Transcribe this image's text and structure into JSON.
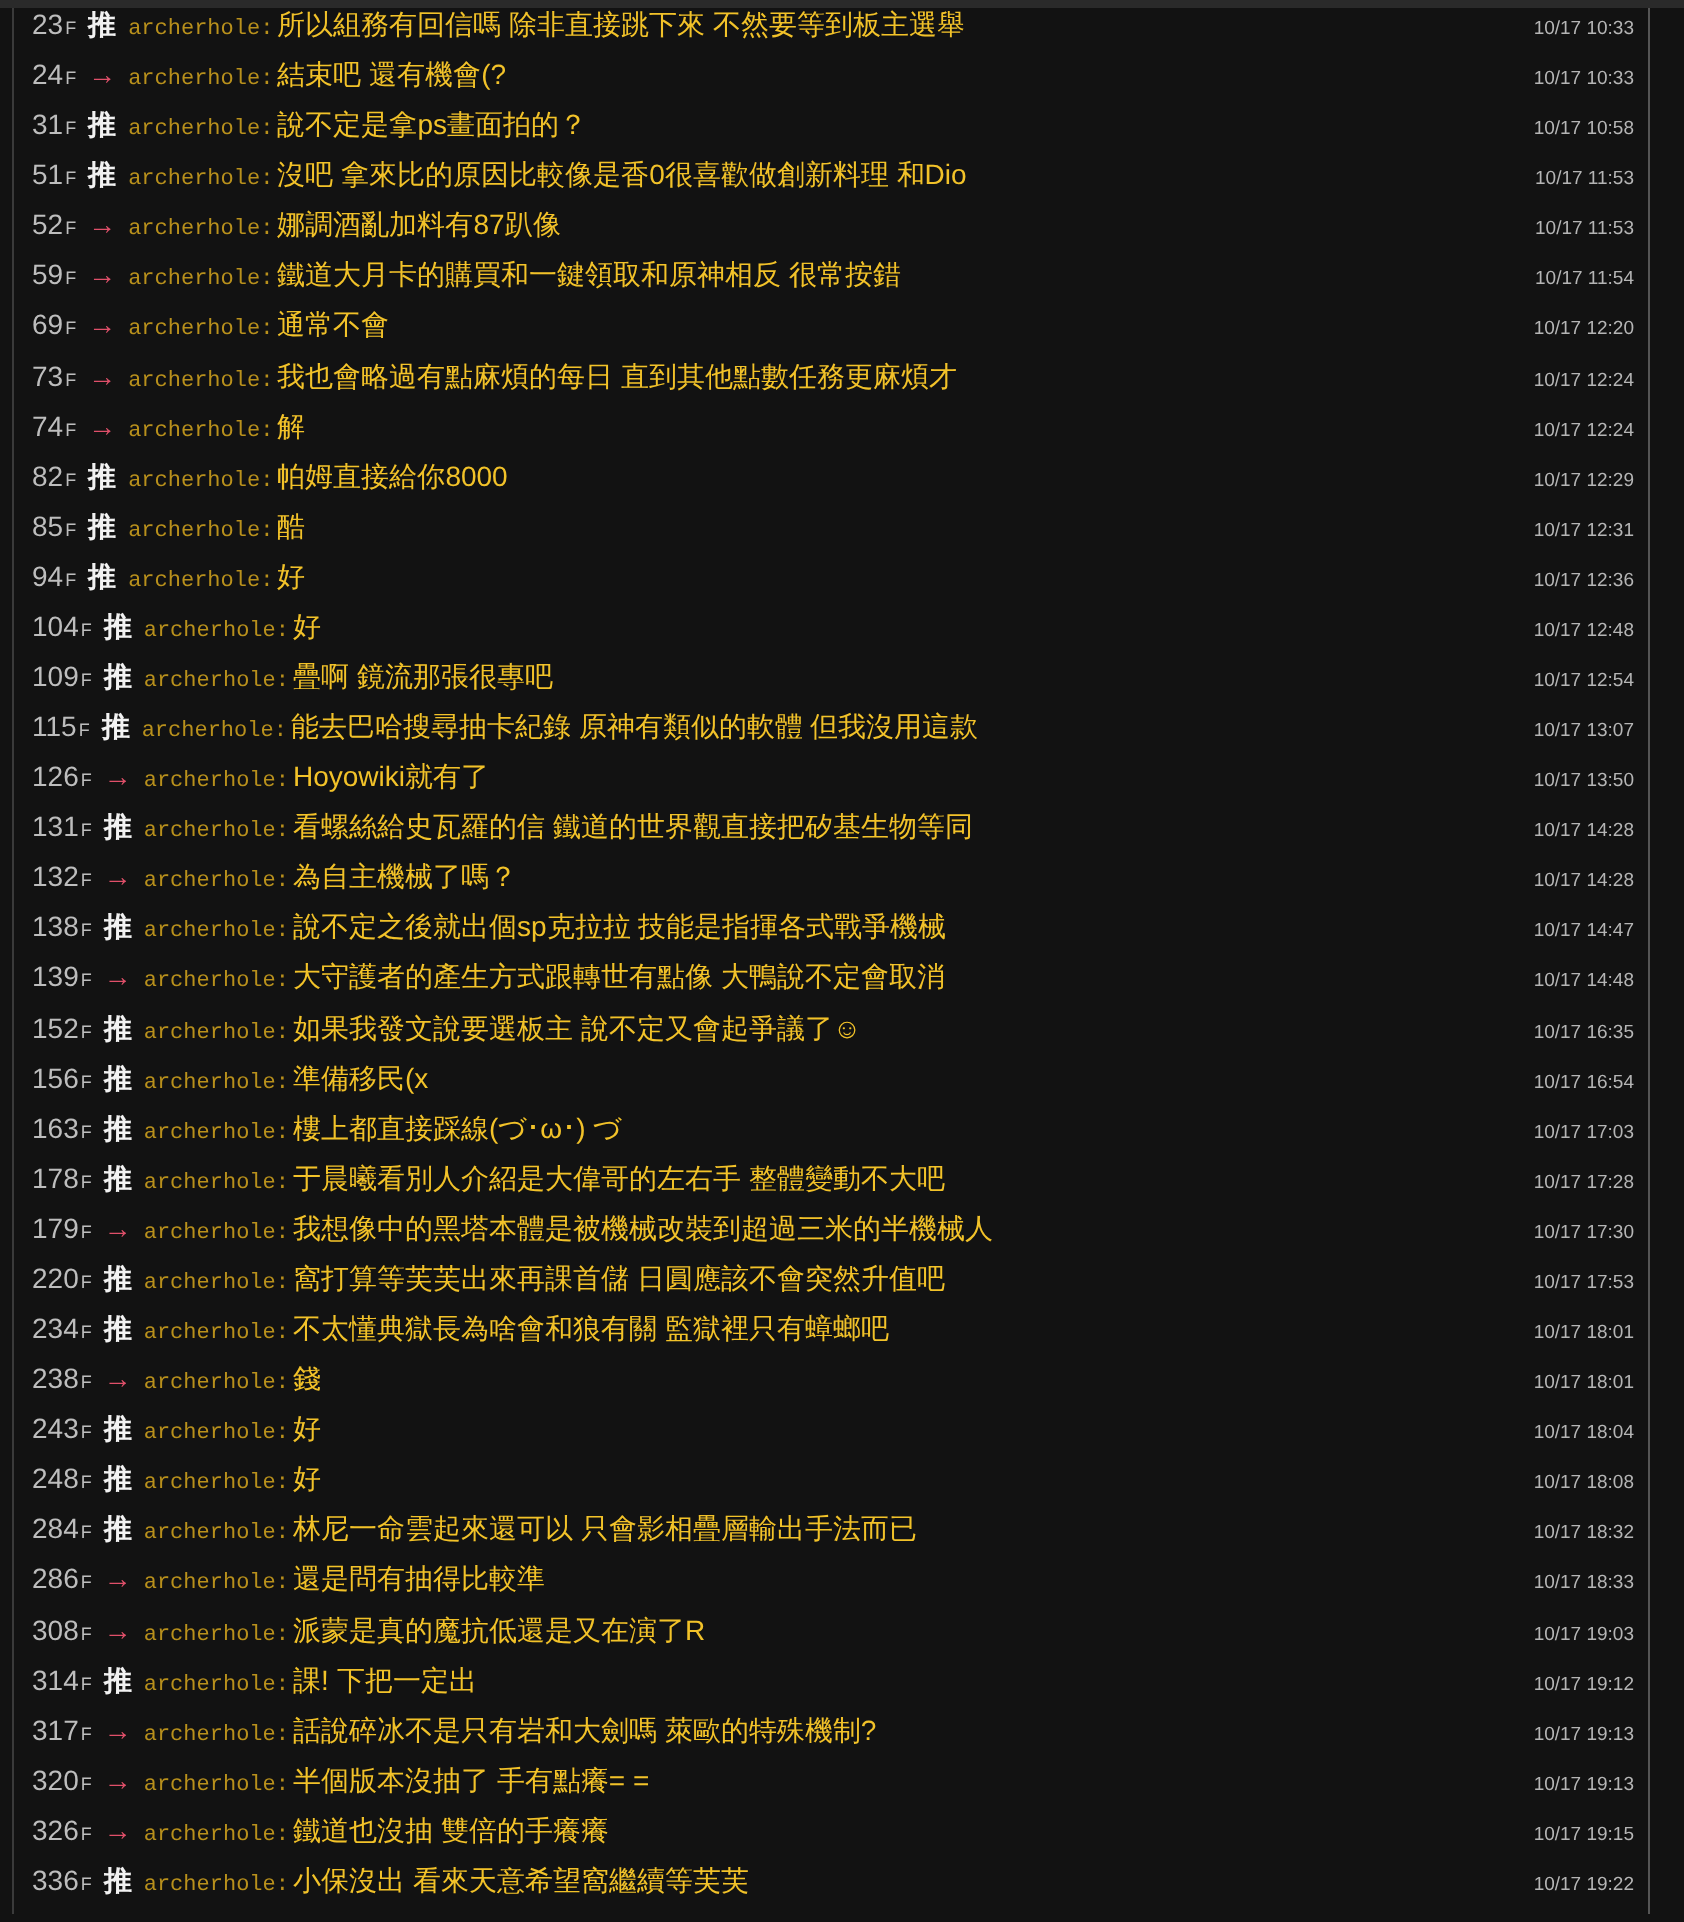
{
  "comments": [
    {
      "floor": "23",
      "floor_mark": "F",
      "kind": "push",
      "tag": "推",
      "user": "archerhole:",
      "content": "所以組務有回信嗎 除非直接跳下來 不然要等到板主選舉",
      "time": "10/17 10:33"
    },
    {
      "floor": "24",
      "floor_mark": "F",
      "kind": "arrow",
      "tag": "→",
      "user": "archerhole:",
      "content": "結束吧 還有機會(?",
      "time": "10/17 10:33"
    },
    {
      "floor": "31",
      "floor_mark": "F",
      "kind": "push",
      "tag": "推",
      "user": "archerhole:",
      "content": "說不定是拿ps畫面拍的？",
      "time": "10/17 10:58"
    },
    {
      "floor": "51",
      "floor_mark": "F",
      "kind": "push",
      "tag": "推",
      "user": "archerhole:",
      "content": "沒吧 拿來比的原因比較像是香0很喜歡做創新料理 和Dio",
      "time": "10/17 11:53"
    },
    {
      "floor": "52",
      "floor_mark": "F",
      "kind": "arrow",
      "tag": "→",
      "user": "archerhole:",
      "content": "娜調酒亂加料有87趴像",
      "time": "10/17 11:53"
    },
    {
      "floor": "59",
      "floor_mark": "F",
      "kind": "arrow",
      "tag": "→",
      "user": "archerhole:",
      "content": "鐵道大月卡的購買和一鍵領取和原神相反 很常按錯",
      "time": "10/17 11:54"
    },
    {
      "floor": "69",
      "floor_mark": "F",
      "kind": "arrow",
      "tag": "→",
      "user": "archerhole:",
      "content": "通常不會",
      "time": "10/17 12:20"
    },
    {
      "floor": "73",
      "floor_mark": "F",
      "kind": "arrow",
      "tag": "→",
      "user": "archerhole:",
      "content": "我也會略過有點麻煩的每日 直到其他點數任務更麻煩才",
      "time": "10/17 12:24"
    },
    {
      "floor": "74",
      "floor_mark": "F",
      "kind": "arrow",
      "tag": "→",
      "user": "archerhole:",
      "content": "解",
      "time": "10/17 12:24"
    },
    {
      "floor": "82",
      "floor_mark": "F",
      "kind": "push",
      "tag": "推",
      "user": "archerhole:",
      "content": "帕姆直接給你8000",
      "time": "10/17 12:29"
    },
    {
      "floor": "85",
      "floor_mark": "F",
      "kind": "push",
      "tag": "推",
      "user": "archerhole:",
      "content": "酷",
      "time": "10/17 12:31"
    },
    {
      "floor": "94",
      "floor_mark": "F",
      "kind": "push",
      "tag": "推",
      "user": "archerhole:",
      "content": "好",
      "time": "10/17 12:36"
    },
    {
      "floor": "104",
      "floor_mark": "F",
      "kind": "push",
      "tag": "推",
      "user": "archerhole:",
      "content": "好",
      "time": "10/17 12:48"
    },
    {
      "floor": "109",
      "floor_mark": "F",
      "kind": "push",
      "tag": "推",
      "user": "archerhole:",
      "content": "疊啊 鏡流那張很專吧",
      "time": "10/17 12:54"
    },
    {
      "floor": "115",
      "floor_mark": "F",
      "kind": "push",
      "tag": "推",
      "user": "archerhole:",
      "content": "能去巴哈搜尋抽卡紀錄 原神有類似的軟體 但我沒用這款",
      "time": "10/17 13:07"
    },
    {
      "floor": "126",
      "floor_mark": "F",
      "kind": "arrow",
      "tag": "→",
      "user": "archerhole:",
      "content": "Hoyowiki就有了",
      "time": "10/17 13:50"
    },
    {
      "floor": "131",
      "floor_mark": "F",
      "kind": "push",
      "tag": "推",
      "user": "archerhole:",
      "content": "看螺絲給史瓦羅的信 鐵道的世界觀直接把矽基生物等同",
      "time": "10/17 14:28"
    },
    {
      "floor": "132",
      "floor_mark": "F",
      "kind": "arrow",
      "tag": "→",
      "user": "archerhole:",
      "content": "為自主機械了嗎？",
      "time": "10/17 14:28"
    },
    {
      "floor": "138",
      "floor_mark": "F",
      "kind": "push",
      "tag": "推",
      "user": "archerhole:",
      "content": "說不定之後就出個sp克拉拉 技能是指揮各式戰爭機械",
      "time": "10/17 14:47"
    },
    {
      "floor": "139",
      "floor_mark": "F",
      "kind": "arrow",
      "tag": "→",
      "user": "archerhole:",
      "content": "大守護者的產生方式跟轉世有點像 大鴨說不定會取消",
      "time": "10/17 14:48"
    },
    {
      "floor": "152",
      "floor_mark": "F",
      "kind": "push",
      "tag": "推",
      "user": "archerhole:",
      "content": "如果我發文說要選板主 說不定又會起爭議了☺",
      "time": "10/17 16:35"
    },
    {
      "floor": "156",
      "floor_mark": "F",
      "kind": "push",
      "tag": "推",
      "user": "archerhole:",
      "content": "準備移民(x",
      "time": "10/17 16:54"
    },
    {
      "floor": "163",
      "floor_mark": "F",
      "kind": "push",
      "tag": "推",
      "user": "archerhole:",
      "content": "樓上都直接踩線(づ･ω･) づ",
      "time": "10/17 17:03"
    },
    {
      "floor": "178",
      "floor_mark": "F",
      "kind": "push",
      "tag": "推",
      "user": "archerhole:",
      "content": "于晨曦看別人介紹是大偉哥的左右手 整體變動不大吧",
      "time": "10/17 17:28"
    },
    {
      "floor": "179",
      "floor_mark": "F",
      "kind": "arrow",
      "tag": "→",
      "user": "archerhole:",
      "content": "我想像中的黑塔本體是被機械改裝到超過三米的半機械人",
      "time": "10/17 17:30"
    },
    {
      "floor": "220",
      "floor_mark": "F",
      "kind": "push",
      "tag": "推",
      "user": "archerhole:",
      "content": "窩打算等芙芙出來再課首儲 日圓應該不會突然升值吧",
      "time": "10/17 17:53"
    },
    {
      "floor": "234",
      "floor_mark": "F",
      "kind": "push",
      "tag": "推",
      "user": "archerhole:",
      "content": "不太懂典獄長為啥會和狼有關 監獄裡只有蟑螂吧",
      "time": "10/17 18:01"
    },
    {
      "floor": "238",
      "floor_mark": "F",
      "kind": "arrow",
      "tag": "→",
      "user": "archerhole:",
      "content": "錢",
      "time": "10/17 18:01"
    },
    {
      "floor": "243",
      "floor_mark": "F",
      "kind": "push",
      "tag": "推",
      "user": "archerhole:",
      "content": "好",
      "time": "10/17 18:04"
    },
    {
      "floor": "248",
      "floor_mark": "F",
      "kind": "push",
      "tag": "推",
      "user": "archerhole:",
      "content": "好",
      "time": "10/17 18:08"
    },
    {
      "floor": "284",
      "floor_mark": "F",
      "kind": "push",
      "tag": "推",
      "user": "archerhole:",
      "content": "林尼一命雲起來還可以 只會影相疊層輸出手法而已",
      "time": "10/17 18:32"
    },
    {
      "floor": "286",
      "floor_mark": "F",
      "kind": "arrow",
      "tag": "→",
      "user": "archerhole:",
      "content": "還是問有抽得比較準",
      "time": "10/17 18:33"
    },
    {
      "floor": "308",
      "floor_mark": "F",
      "kind": "arrow",
      "tag": "→",
      "user": "archerhole:",
      "content": "派蒙是真的魔抗低還是又在演了R",
      "time": "10/17 19:03"
    },
    {
      "floor": "314",
      "floor_mark": "F",
      "kind": "push",
      "tag": "推",
      "user": "archerhole:",
      "content": "課! 下把一定出",
      "time": "10/17 19:12"
    },
    {
      "floor": "317",
      "floor_mark": "F",
      "kind": "arrow",
      "tag": "→",
      "user": "archerhole:",
      "content": "話說碎冰不是只有岩和大劍嗎 萊歐的特殊機制?",
      "time": "10/17 19:13"
    },
    {
      "floor": "320",
      "floor_mark": "F",
      "kind": "arrow",
      "tag": "→",
      "user": "archerhole:",
      "content": "半個版本沒抽了 手有點癢= =",
      "time": "10/17 19:13"
    },
    {
      "floor": "326",
      "floor_mark": "F",
      "kind": "arrow",
      "tag": "→",
      "user": "archerhole:",
      "content": "鐵道也沒抽 雙倍的手癢癢",
      "time": "10/17 19:15"
    },
    {
      "floor": "336",
      "floor_mark": "F",
      "kind": "push",
      "tag": "推",
      "user": "archerhole:",
      "content": "小保沒出 看來天意希望窩繼續等芙芙",
      "time": "10/17 19:22"
    }
  ]
}
